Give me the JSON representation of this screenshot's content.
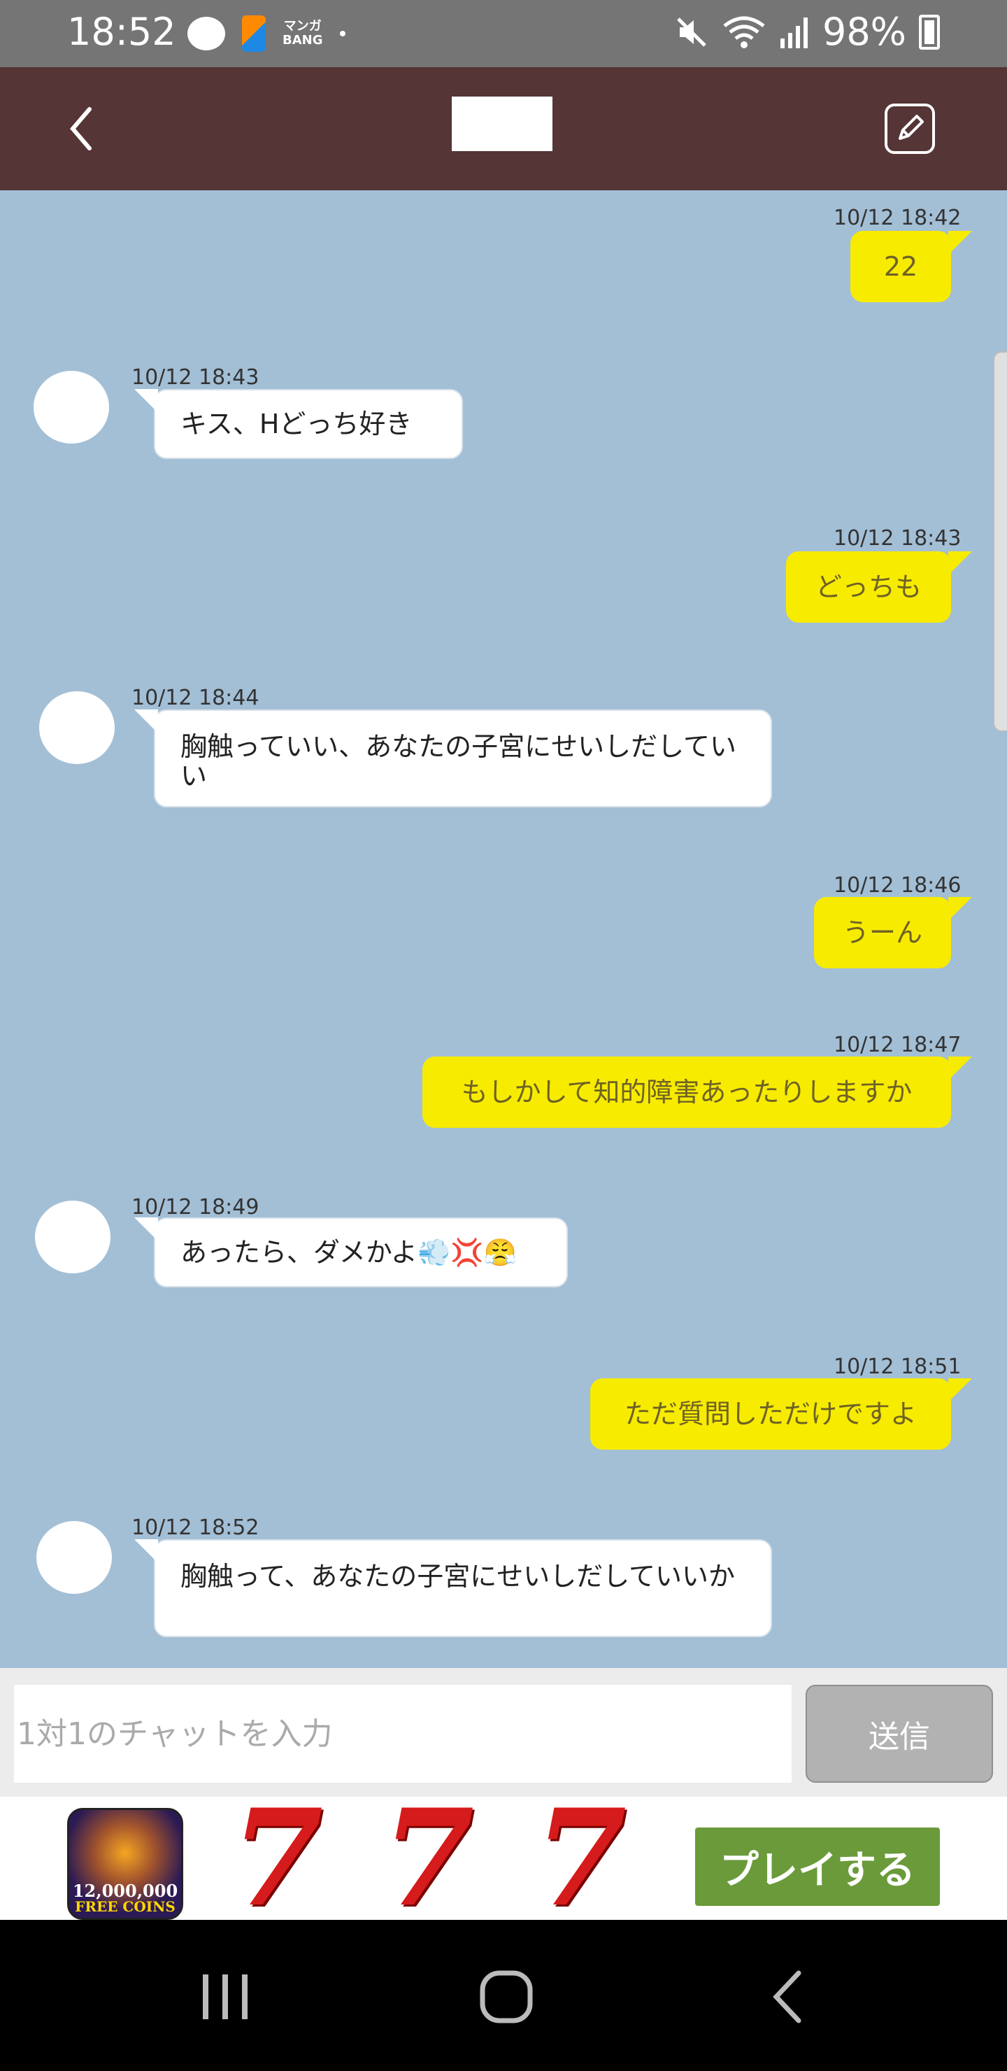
{
  "status_bar": {
    "time": "18:52",
    "manga_label_top": "マンガ",
    "manga_label_bottom": "BANG",
    "battery": "98%"
  },
  "header": {
    "back_icon": "chevron-left-icon",
    "edit_icon": "pencil-icon"
  },
  "messages": [
    {
      "side": "out",
      "time": "10/12 18:42",
      "text": "22"
    },
    {
      "side": "in",
      "time": "10/12 18:43",
      "text": "キス、Hどっち好き"
    },
    {
      "side": "out",
      "time": "10/12 18:43",
      "text": "どっちも"
    },
    {
      "side": "in",
      "time": "10/12 18:44",
      "text": "胸触っていい、あなたの子宮にせいしだしていい"
    },
    {
      "side": "out",
      "time": "10/12 18:46",
      "text": "うーん"
    },
    {
      "side": "out",
      "time": "10/12 18:47",
      "text": "もしかして知的障害あったりしますか"
    },
    {
      "side": "in",
      "time": "10/12 18:49",
      "text": "あったら、ダメかよ💨💢😤"
    },
    {
      "side": "out",
      "time": "10/12 18:51",
      "text": "ただ質問しただけですよ"
    },
    {
      "side": "in",
      "time": "10/12 18:52",
      "text": "胸触って、あなたの子宮にせいしだしていいか"
    }
  ],
  "composer": {
    "placeholder": "1対1のチャットを入力",
    "send_label": "送信"
  },
  "ad": {
    "coins_amount": "12,000,000",
    "coins_label": "FREE COINS",
    "sevens": [
      "7",
      "7",
      "7"
    ],
    "play_label": "プレイする",
    "play_color": "#6a9a3a"
  },
  "colors": {
    "chat_background": "#a3bfd6",
    "header": "#553535",
    "outgoing_bubble": "#f7eb00"
  }
}
